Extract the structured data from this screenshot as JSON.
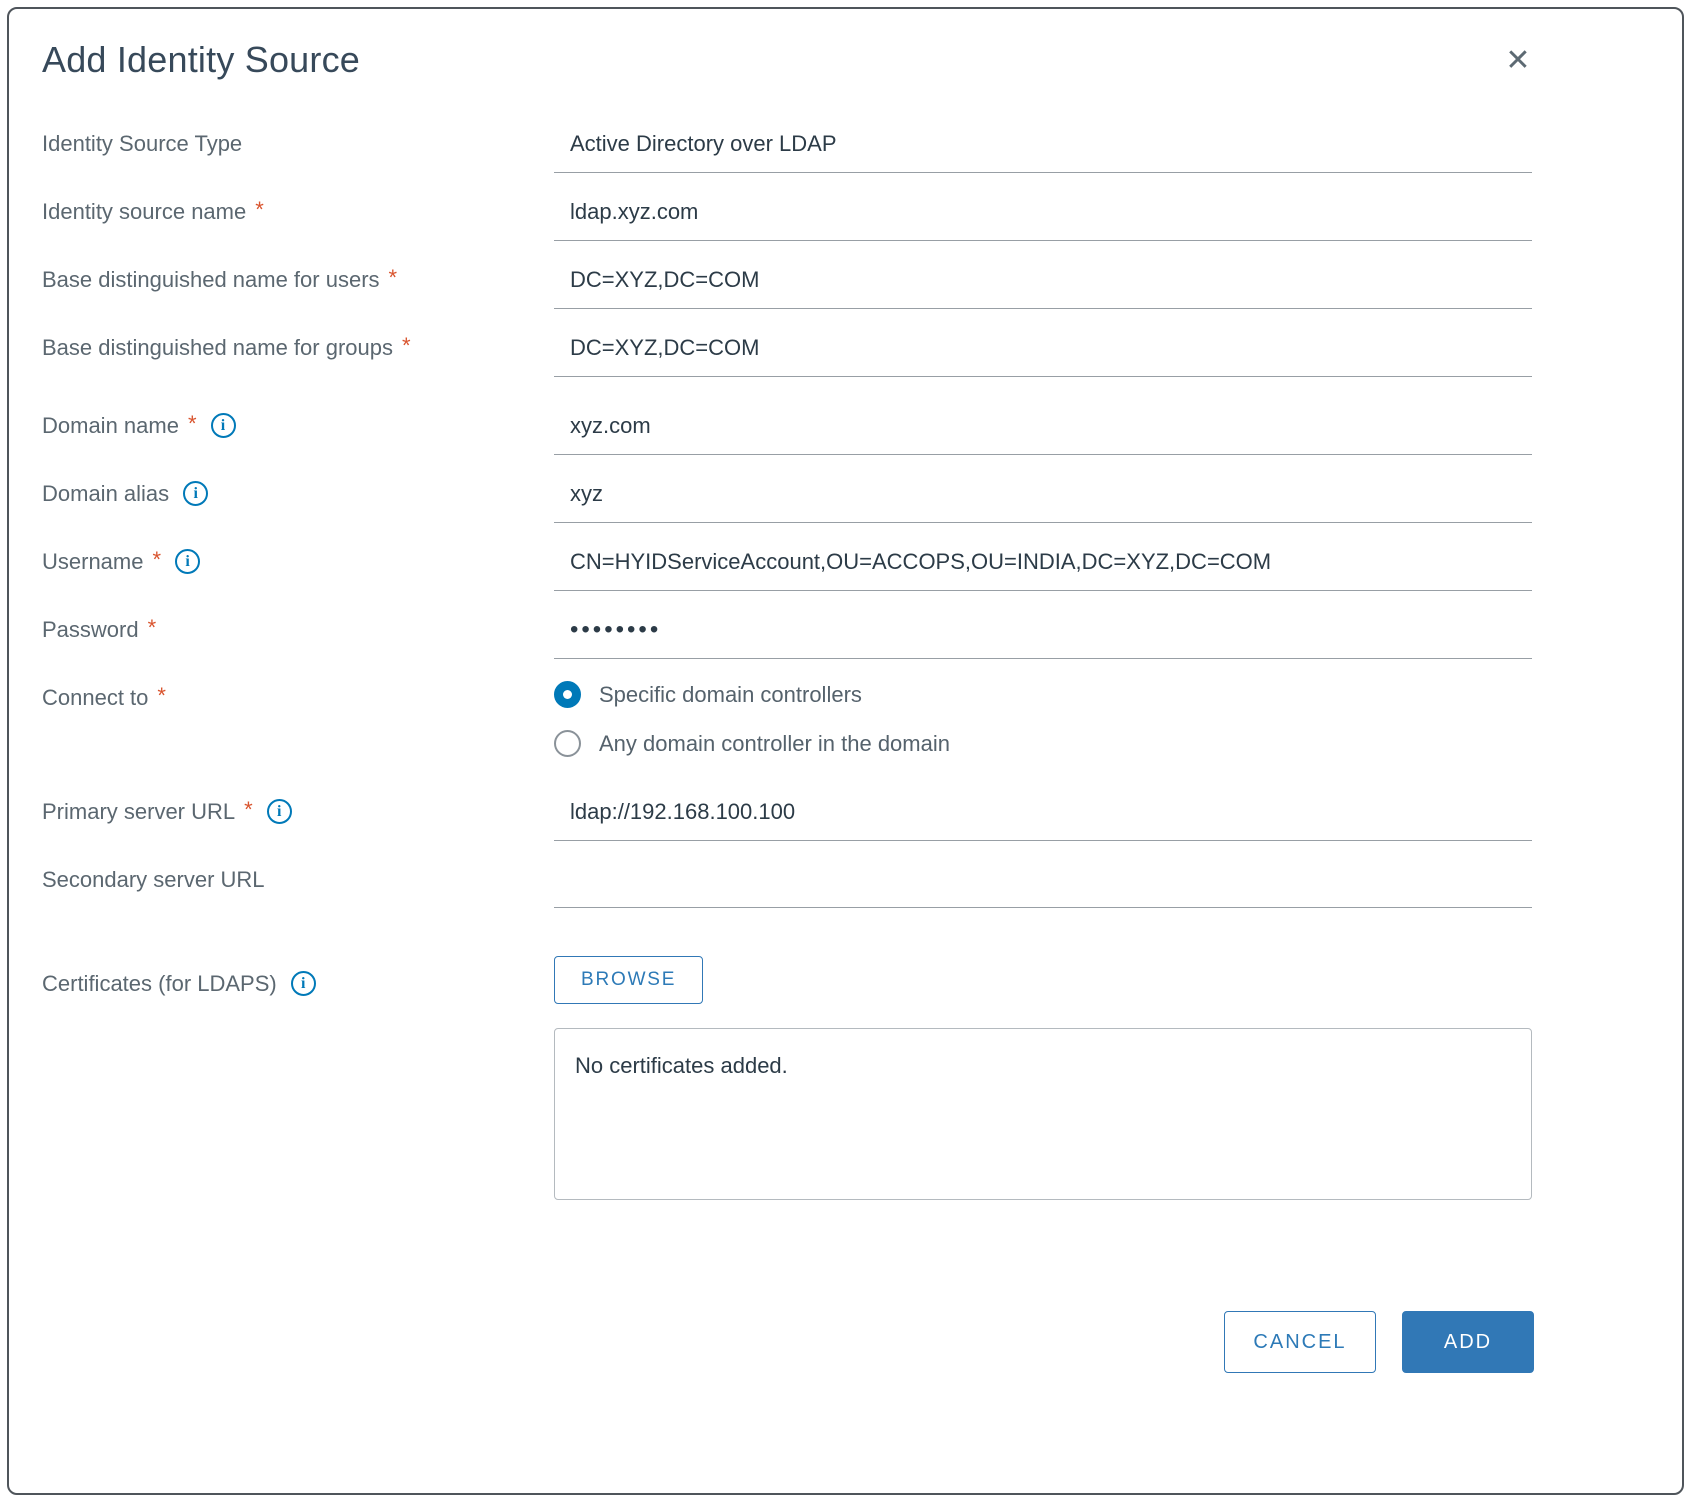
{
  "dialog": {
    "title": "Add Identity Source"
  },
  "icons": {
    "close": "✕",
    "info": "i"
  },
  "fields": {
    "identity_source_type": {
      "label": "Identity Source Type",
      "value": "Active Directory over LDAP"
    },
    "identity_source_name": {
      "label": "Identity source name",
      "required": "*",
      "value": "ldap.xyz.com"
    },
    "base_dn_users": {
      "label": "Base distinguished name for users",
      "required": "*",
      "value": "DC=XYZ,DC=COM"
    },
    "base_dn_groups": {
      "label": "Base distinguished name for groups",
      "required": "*",
      "value": "DC=XYZ,DC=COM"
    },
    "domain_name": {
      "label": "Domain name",
      "required": "*",
      "value": "xyz.com"
    },
    "domain_alias": {
      "label": "Domain alias",
      "value": "xyz"
    },
    "username": {
      "label": "Username",
      "required": "*",
      "value": "CN=HYIDServiceAccount,OU=ACCOPS,OU=INDIA,DC=XYZ,DC=COM"
    },
    "password": {
      "label": "Password",
      "required": "*",
      "value": "••••••••"
    },
    "connect_to": {
      "label": "Connect to",
      "required": "*",
      "options": [
        {
          "label": "Specific domain controllers",
          "selected": true
        },
        {
          "label": "Any domain controller in the domain",
          "selected": false
        }
      ]
    },
    "primary_server_url": {
      "label": "Primary server URL",
      "required": "*",
      "value": "ldap://192.168.100.100"
    },
    "secondary_server_url": {
      "label": "Secondary server URL",
      "value": ""
    },
    "certificates": {
      "label": "Certificates (for LDAPS)",
      "browse_label": "BROWSE",
      "empty_text": "No certificates added."
    }
  },
  "footer": {
    "cancel_label": "CANCEL",
    "add_label": "ADD"
  },
  "colors": {
    "accent_blue": "#0079b8",
    "button_blue": "#3178b6",
    "required_red": "#d9542e",
    "label_gray": "#5b6770",
    "value_dark": "#2c3b47"
  }
}
